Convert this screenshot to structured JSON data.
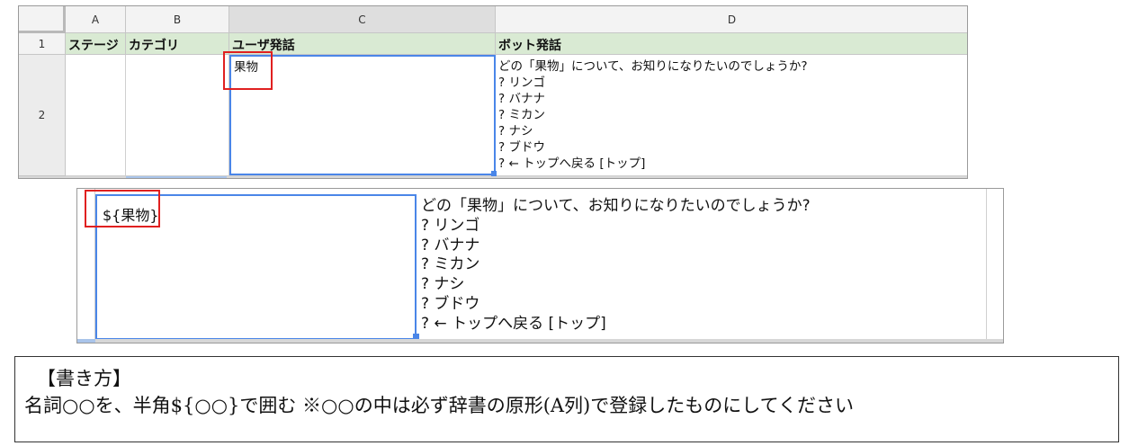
{
  "sheet1": {
    "columns": [
      "A",
      "B",
      "C",
      "D"
    ],
    "rows": [
      "1",
      "2"
    ],
    "header_row": [
      "ステージ",
      "カテゴリ",
      "ユーザ発話",
      "ボット発話"
    ],
    "row2": {
      "a": "",
      "b": "",
      "c": "果物",
      "d": [
        "どの「果物」について、お知りになりたいのでしょうか?",
        "? リンゴ",
        "? バナナ",
        "? ミカン",
        "? ナシ",
        "? ブドウ",
        "? ← トップへ戻る [トップ]"
      ]
    }
  },
  "sheet2": {
    "c": "${果物}",
    "d": [
      "どの「果物」について、お知りになりたいのでしょうか?",
      "? リンゴ",
      "? バナナ",
      "? ミカン",
      "? ナシ",
      "? ブドウ",
      "? ← トップへ戻る [トップ]"
    ]
  },
  "note": {
    "title": "【書き方】",
    "body": "名詞○○を、半角${○○}で囲む ※○○の中は必ず辞書の原形(A列)で登録したものにしてください"
  },
  "colors": {
    "header_green": "#d9ead3",
    "selection_blue": "#4a86e8",
    "highlight_red": "#e02020"
  }
}
